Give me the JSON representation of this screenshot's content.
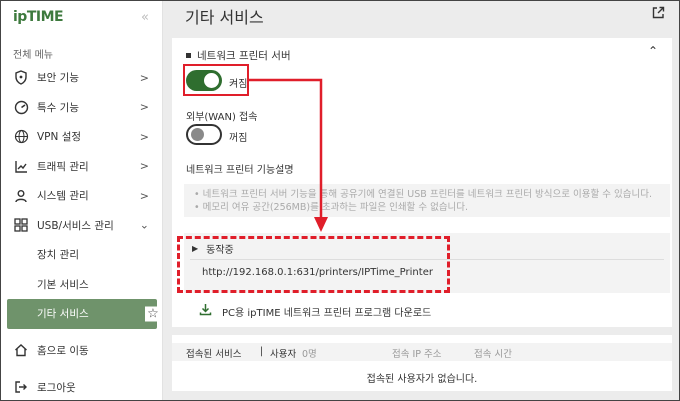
{
  "sidebar": {
    "logo": "ipTIME",
    "menu_head": "전체 메뉴",
    "items": [
      {
        "label": "보안 기능"
      },
      {
        "label": "특수 기능"
      },
      {
        "label": "VPN 설정"
      },
      {
        "label": "트래픽 관리"
      },
      {
        "label": "시스템 관리"
      },
      {
        "label": "USB/서비스 관리"
      }
    ],
    "sub_items": [
      {
        "label": "장치 관리"
      },
      {
        "label": "기본 서비스"
      },
      {
        "label": "기타 서비스"
      }
    ],
    "home": "홈으로 이동",
    "logout": "로그아웃"
  },
  "main": {
    "title": "기타 서비스",
    "section_title": "네트워크 프린터 서버",
    "toggle_on_label": "켜짐",
    "wan_label": "외부(WAN) 접속",
    "toggle_off_label": "꺼짐",
    "desc_title": "네트워크 프린터 기능설명",
    "desc_lines": [
      "• 네트워크 프린터 서버 기능을 통해 공유기에 연결된 USB 프린터를 네트워크 프린터 방식으로 이용할 수 있습니다.",
      "• 메모리 여유 공간(256MB)를 초과하는 파일은 인쇄할 수 없습니다."
    ],
    "status": "동작중",
    "url": "http://192.168.0.1:631/printers/IPTime_Printer",
    "download": "PC용 ipTIME 네트워크 프린터 프로그램 다운로드"
  },
  "table": {
    "connected": "접속된 서비스",
    "sep": "|",
    "user": "사용자",
    "count": "0명",
    "ip_col": "접속 IP 주소",
    "time_col": "접속 시간",
    "empty": "접속된 사용자가 없습니다."
  },
  "colors": {
    "accent": "#2f6e2f",
    "active_bg": "#6f936b",
    "highlight": "#e01e2a"
  }
}
